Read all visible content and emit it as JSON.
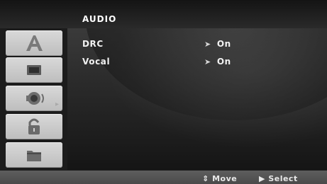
{
  "header": {
    "title": "AUDIO"
  },
  "sidebar": {
    "tabs": [
      {
        "icon": "language-a-icon"
      },
      {
        "icon": "display-icon"
      },
      {
        "icon": "audio-speaker-icon"
      },
      {
        "icon": "lock-icon"
      },
      {
        "icon": "others-folder-icon"
      }
    ],
    "selected_index": 2,
    "selected_arrow": "▸"
  },
  "menu": {
    "items": [
      {
        "label": "DRC",
        "value": "On",
        "arrow": "➤"
      },
      {
        "label": "Vocal",
        "value": "On",
        "arrow": "➤"
      }
    ]
  },
  "footer": {
    "move": {
      "glyph": "⇕",
      "label": "Move"
    },
    "select": {
      "glyph": "▶",
      "label": "Select"
    }
  },
  "colors": {
    "background": "#1c1c1c",
    "sidebar_tab": "#cfcfcf",
    "text": "#f2f2f2"
  }
}
